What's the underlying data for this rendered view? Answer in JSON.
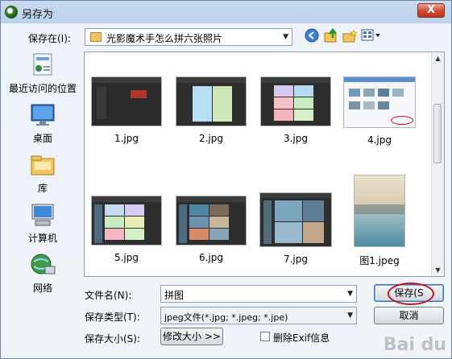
{
  "window": {
    "title": "另存为",
    "close_label": "X"
  },
  "location": {
    "label": "保存在(I):",
    "current_folder": "光影魔术手怎么拼六张照片"
  },
  "places": [
    {
      "label": "最近访问的位置",
      "icon": "recent-places-icon"
    },
    {
      "label": "桌面",
      "icon": "desktop-icon"
    },
    {
      "label": "库",
      "icon": "library-icon"
    },
    {
      "label": "计算机",
      "icon": "computer-icon"
    },
    {
      "label": "网络",
      "icon": "network-icon"
    }
  ],
  "files": [
    {
      "name": "1.jpg"
    },
    {
      "name": "2.jpg"
    },
    {
      "name": "3.jpg"
    },
    {
      "name": "4.jpg"
    },
    {
      "name": "5.jpg"
    },
    {
      "name": "6.jpg"
    },
    {
      "name": "7.jpg"
    },
    {
      "name": "图1.jpeg"
    }
  ],
  "form": {
    "filename_label": "文件名(N):",
    "filename_value": "拼图",
    "filetype_label": "保存类型(T):",
    "filetype_value": "jpeg文件(*.jpg; *.jpeg; *.jpe)",
    "size_label": "保存大小(S):",
    "resize_button": "修改大小 >>",
    "exif_checkbox": "删除Exif信息",
    "exif_checked": false
  },
  "buttons": {
    "save": "保存(S",
    "cancel": "取消"
  },
  "watermark": "Bai du",
  "colors": {
    "accent": "#c8141a",
    "title_bar": "#c9daf0"
  }
}
